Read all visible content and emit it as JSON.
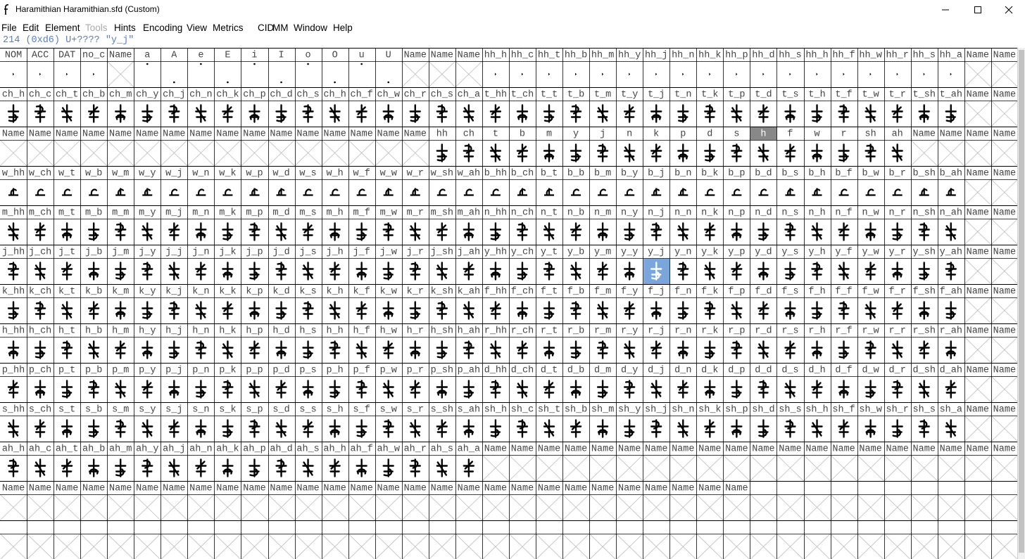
{
  "window": {
    "title": "Haramithian  Haramithian.sfd (Custom)"
  },
  "menu": [
    {
      "label": "File",
      "enabled": true
    },
    {
      "label": "Edit",
      "enabled": true
    },
    {
      "label": "Element",
      "enabled": true
    },
    {
      "label": "Tools",
      "enabled": false
    },
    {
      "label": "Hints",
      "enabled": true
    },
    {
      "label": "Encoding",
      "enabled": true
    },
    {
      "label": "View",
      "enabled": true
    },
    {
      "label": "Metrics",
      "enabled": true
    },
    {
      "label": "CID",
      "enabled": true
    },
    {
      "label": "MM",
      "enabled": true
    },
    {
      "label": "Window",
      "enabled": true
    },
    {
      "label": "Help",
      "enabled": true
    }
  ],
  "status": "214 (0xd6) U+???? \"y_j\"",
  "selected_glyph": "y_j",
  "highlighted_label": "h",
  "rows": [
    {
      "labels": [
        "NOM",
        "ACC",
        "DAT",
        "no_c",
        "Name",
        "a",
        "A",
        "e",
        "E",
        "i",
        "I",
        "o",
        "O",
        "u",
        "U",
        "Name",
        "Name",
        "Name",
        "hh_h",
        "hh_c",
        "hh_t",
        "hh_b",
        "hh_m",
        "hh_y",
        "hh_j",
        "hh_n",
        "hh_k",
        "hh_p",
        "hh_d",
        "hh_s",
        "hh_h",
        "hh_f",
        "hh_w",
        "hh_r",
        "hh_s",
        "hh_a",
        "Name",
        "Name"
      ]
    },
    {
      "labels": [
        "ch_h",
        "ch_c",
        "ch_t",
        "ch_b",
        "ch_m",
        "ch_y",
        "ch_j",
        "ch_n",
        "ch_k",
        "ch_p",
        "ch_d",
        "ch_s",
        "ch_h",
        "ch_f",
        "ch_w",
        "ch_r",
        "ch_s",
        "ch_a",
        "t_hh",
        "t_ch",
        "t_t",
        "t_b",
        "t_m",
        "t_y",
        "t_j",
        "t_n",
        "t_k",
        "t_p",
        "t_d",
        "t_s",
        "t_h",
        "t_f",
        "t_w",
        "t_r",
        "t_sh",
        "t_ah",
        "Name",
        "Name"
      ]
    },
    {
      "labels": [
        "Name",
        "Name",
        "Name",
        "Name",
        "Name",
        "Name",
        "Name",
        "Name",
        "Name",
        "Name",
        "Name",
        "Name",
        "Name",
        "Name",
        "Name",
        "Name",
        "hh",
        "ch",
        "t",
        "b",
        "m",
        "y",
        "j",
        "n",
        "k",
        "p",
        "d",
        "s",
        "h",
        "f",
        "w",
        "r",
        "sh",
        "ah",
        "Name",
        "Name",
        "Name",
        "Name"
      ]
    },
    {
      "labels": [
        "w_hh",
        "w_ch",
        "w_t",
        "w_b",
        "w_m",
        "w_y",
        "w_j",
        "w_n",
        "w_k",
        "w_p",
        "w_d",
        "w_s",
        "w_h",
        "w_f",
        "w_w",
        "w_r",
        "w_sh",
        "w_ah",
        "b_hh",
        "b_ch",
        "b_t",
        "b_b",
        "b_m",
        "b_y",
        "b_j",
        "b_n",
        "b_k",
        "b_p",
        "b_d",
        "b_s",
        "b_h",
        "b_f",
        "b_w",
        "b_r",
        "b_sh",
        "b_ah",
        "Name",
        "Name"
      ]
    },
    {
      "labels": [
        "m_hh",
        "m_ch",
        "m_t",
        "m_b",
        "m_m",
        "m_y",
        "m_j",
        "m_n",
        "m_k",
        "m_p",
        "m_d",
        "m_s",
        "m_h",
        "m_f",
        "m_w",
        "m_r",
        "m_sh",
        "m_ah",
        "n_hh",
        "n_ch",
        "n_t",
        "n_b",
        "n_m",
        "n_y",
        "n_j",
        "n_n",
        "n_k",
        "n_p",
        "n_d",
        "n_s",
        "n_h",
        "n_f",
        "n_w",
        "n_r",
        "n_sh",
        "n_ah",
        "Name",
        "Name"
      ]
    },
    {
      "labels": [
        "j_hh",
        "j_ch",
        "j_t",
        "j_b",
        "j_m",
        "j_y",
        "j_j",
        "j_n",
        "j_k",
        "j_p",
        "j_d",
        "j_s",
        "j_h",
        "j_f",
        "j_w",
        "j_r",
        "j_sh",
        "j_ah",
        "y_hh",
        "y_ch",
        "y_t",
        "y_b",
        "y_m",
        "y_y",
        "y_j",
        "y_n",
        "y_k",
        "y_p",
        "y_d",
        "y_s",
        "y_h",
        "y_f",
        "y_w",
        "y_r",
        "y_sh",
        "y_ah",
        "Name",
        "Name"
      ]
    },
    {
      "labels": [
        "k_hh",
        "k_ch",
        "k_t",
        "k_b",
        "k_m",
        "k_y",
        "k_j",
        "k_n",
        "k_k",
        "k_p",
        "k_d",
        "k_s",
        "k_h",
        "k_f",
        "k_w",
        "k_r",
        "k_sh",
        "k_ah",
        "f_hh",
        "f_ch",
        "f_t",
        "f_b",
        "f_m",
        "f_y",
        "f_j",
        "f_n",
        "f_k",
        "f_p",
        "f_d",
        "f_s",
        "f_h",
        "f_f",
        "f_w",
        "f_r",
        "f_sh",
        "f_ah",
        "Name",
        "Name"
      ]
    },
    {
      "labels": [
        "h_hh",
        "h_ch",
        "h_t",
        "h_b",
        "h_m",
        "h_y",
        "h_j",
        "h_n",
        "h_k",
        "h_p",
        "h_d",
        "h_s",
        "h_h",
        "h_f",
        "h_w",
        "h_r",
        "h_sh",
        "h_ah",
        "r_hh",
        "r_ch",
        "r_t",
        "r_b",
        "r_m",
        "r_y",
        "r_j",
        "r_n",
        "r_k",
        "r_p",
        "r_d",
        "r_s",
        "r_h",
        "r_f",
        "r_w",
        "r_r",
        "r_sh",
        "r_ah",
        "Name",
        "Name"
      ]
    },
    {
      "labels": [
        "p_hh",
        "p_ch",
        "p_t",
        "p_b",
        "p_m",
        "p_y",
        "p_j",
        "p_n",
        "p_k",
        "p_p",
        "p_d",
        "p_s",
        "p_h",
        "p_f",
        "p_w",
        "p_r",
        "p_sh",
        "p_ah",
        "d_hh",
        "d_ch",
        "d_t",
        "d_b",
        "d_m",
        "d_y",
        "d_j",
        "d_n",
        "d_k",
        "d_p",
        "d_d",
        "d_s",
        "d_h",
        "d_f",
        "d_w",
        "d_r",
        "d_sh",
        "d_ah",
        "Name",
        "Name"
      ]
    },
    {
      "labels": [
        "s_hh",
        "s_ch",
        "s_t",
        "s_b",
        "s_m",
        "s_y",
        "s_j",
        "s_n",
        "s_k",
        "s_p",
        "s_d",
        "s_s",
        "s_h",
        "s_f",
        "s_w",
        "s_r",
        "s_sh",
        "s_ah",
        "sh_h",
        "sh_c",
        "sh_t",
        "sh_b",
        "sh_m",
        "sh_y",
        "sh_j",
        "sh_n",
        "sh_k",
        "sh_p",
        "sh_d",
        "sh_s",
        "sh_h",
        "sh_f",
        "sh_w",
        "sh_r",
        "sh_s",
        "sh_a",
        "Name",
        "Name"
      ]
    },
    {
      "labels": [
        "ah_h",
        "ah_c",
        "ah_t",
        "ah_b",
        "ah_m",
        "ah_y",
        "ah_j",
        "ah_n",
        "ah_k",
        "ah_p",
        "ah_d",
        "ah_s",
        "ah_h",
        "ah_f",
        "ah_w",
        "ah_r",
        "ah_s",
        "ah_a",
        "Name",
        "Name",
        "Name",
        "Name",
        "Name",
        "Name",
        "Name",
        "Name",
        "Name",
        "Name",
        "Name",
        "Name",
        "Name",
        "Name",
        "Name",
        "Name",
        "Name",
        "Name",
        "Name",
        "Name"
      ]
    },
    {
      "labels": [
        "Name",
        "Name",
        "Name",
        "Name",
        "Name",
        "Name",
        "Name",
        "Name",
        "Name",
        "Name",
        "Name",
        "Name",
        "Name",
        "Name",
        "Name",
        "Name",
        "Name",
        "Name",
        "Name",
        "Name",
        "Name",
        "Name",
        "Name",
        "Name",
        "Name",
        "Name",
        "Name",
        "Name",
        "",
        "",
        "",
        "",
        "",
        "",
        "",
        "",
        "",
        ""
      ]
    },
    {
      "labels": []
    }
  ],
  "glyph_kinds": [
    "diacritic",
    "ligature",
    "ligature",
    "empty",
    "ligature",
    "ligature",
    "ligature",
    "ligature",
    "ligature",
    "ligature",
    "ligature",
    "empty",
    "blank"
  ]
}
